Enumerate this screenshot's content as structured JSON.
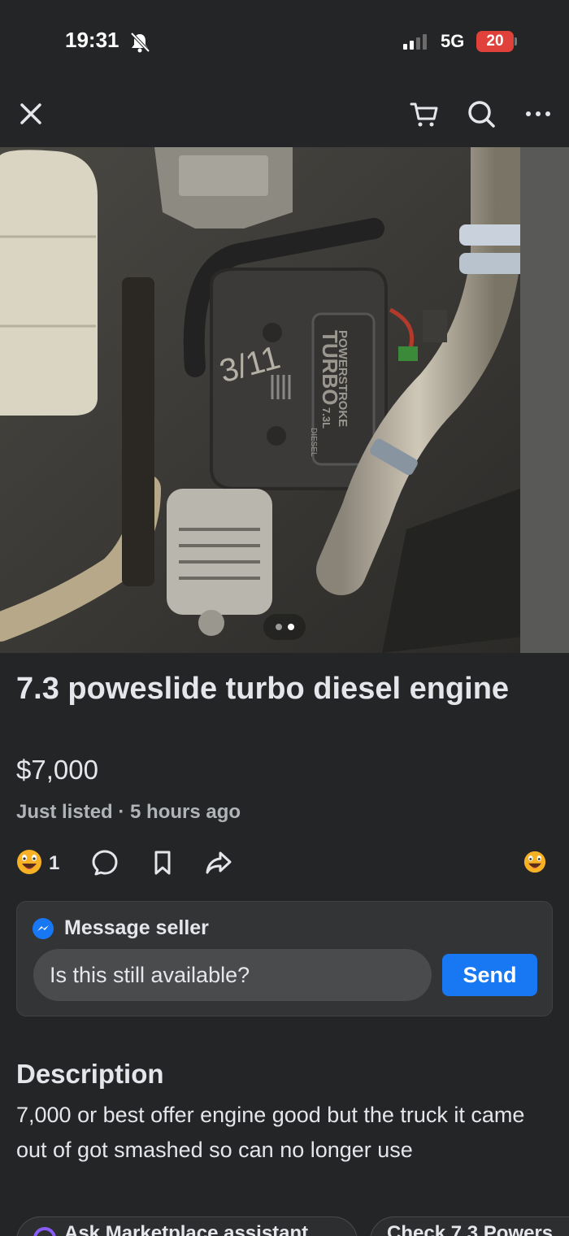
{
  "status_bar": {
    "time": "19:31",
    "network": "5G",
    "battery": "20",
    "battery_color": "#e0413a"
  },
  "nav": {
    "icons": [
      "close-icon",
      "cart-icon",
      "search-icon",
      "more-icon"
    ]
  },
  "photo": {
    "engine_label_line1": "POWERSTROKE",
    "engine_label_line2": "TURBO",
    "engine_label_line3": "7.3L",
    "engine_label_line4": "DIESEL",
    "marker_text": "3/11",
    "pager_current": 2,
    "pager_total": 2
  },
  "listing": {
    "title": "7.3 poweslide turbo diesel engine",
    "price": "$7,000",
    "listed": "Just listed · 5 hours ago"
  },
  "actions": {
    "reaction_count": "1",
    "icons": [
      "reaction-icon",
      "comment-icon",
      "save-icon",
      "share-icon",
      "reaction-emoji-icon"
    ]
  },
  "message": {
    "header": "Message seller",
    "input_value": "Is this still available?",
    "send_label": "Send",
    "accent": "#1877f2"
  },
  "description": {
    "heading": "Description",
    "body": "7,000 or best offer engine good but the truck it came out of got smashed so can no longer use"
  },
  "chips": {
    "chip1": "Ask Marketplace assistant",
    "chip2": "Check 7.3 Powers"
  }
}
